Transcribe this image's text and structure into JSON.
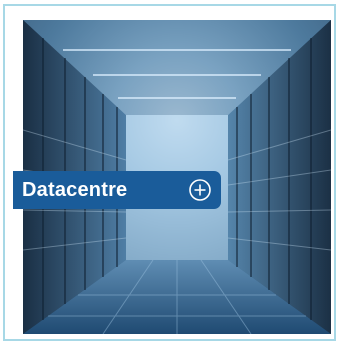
{
  "tile": {
    "label": "Datacentre",
    "action_icon": "plus-circle-icon",
    "image_subject": "server-room-aisle",
    "colors": {
      "border": "#a7d8e6",
      "label_background": "#1a5c9a",
      "label_text": "#ffffff"
    }
  }
}
